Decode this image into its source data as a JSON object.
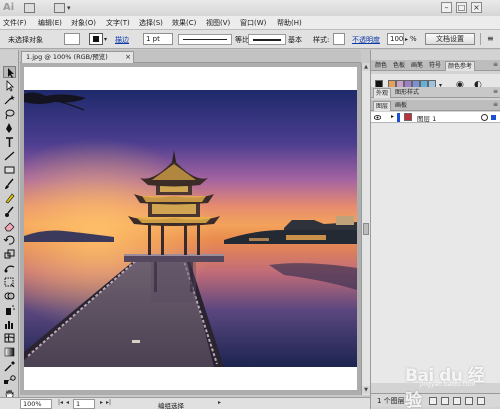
{
  "app": {
    "logo": "Ai"
  },
  "menu": [
    "文件(F)",
    "编辑(E)",
    "对象(O)",
    "文字(T)",
    "选择(S)",
    "效果(C)",
    "视图(V)",
    "窗口(W)",
    "帮助(H)"
  ],
  "control": {
    "selection_label": "未选择对象",
    "stroke_label": "描边",
    "stroke_weight": "1 pt",
    "profile_label": "等比",
    "brush_label": "基本",
    "style_label": "样式:",
    "opacity_label": "不透明度",
    "opacity_value": "100",
    "opacity_unit": "%",
    "doc_setup_button": "文档设置"
  },
  "document": {
    "tab_title": "1.jpg @ 100% (RGB/预览)"
  },
  "status": {
    "zoom": "100%",
    "page": "1",
    "mode": "编组选择"
  },
  "panels": {
    "top_tabs": [
      "颜色",
      "色板",
      "画笔",
      "符号",
      "颜色参考"
    ],
    "appearance_tabs": [
      "外观",
      "图形样式"
    ],
    "layer_tabs": [
      "图层",
      "画板"
    ],
    "layer_name": "图层 1",
    "layer_count": "1 个图层"
  },
  "swatch_colors": [
    "#e3a15b",
    "#c9a0c8",
    "#9d7fc7",
    "#7f8fd3",
    "#63b0d8",
    "#9fc2dc"
  ],
  "watermark": {
    "brand": "Bai du 经验",
    "url": "jingyan.baidu.com"
  }
}
